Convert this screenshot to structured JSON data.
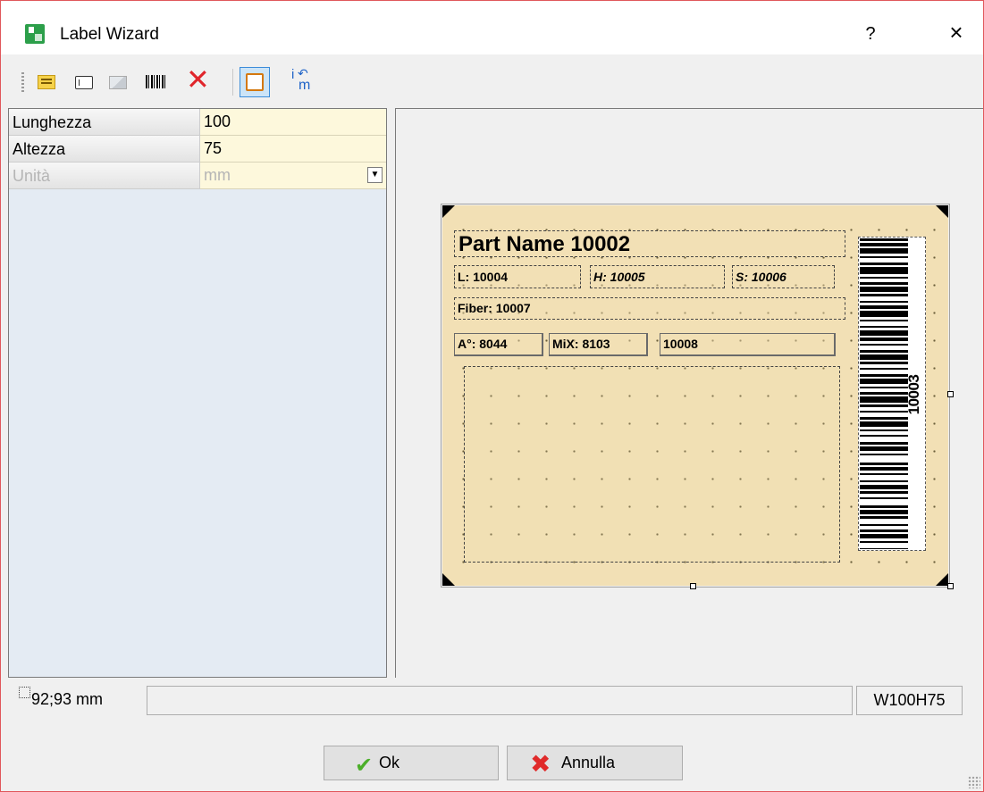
{
  "window": {
    "title": "Label Wizard",
    "help": "?",
    "close": "×"
  },
  "toolbar": {
    "items": [
      "text-icon",
      "field-icon",
      "image-icon",
      "barcode-icon",
      "delete-icon",
      "frame-icon",
      "unit-icon"
    ],
    "delete_glyph": "✕",
    "unit_i": "i",
    "unit_arrow": "↶",
    "unit_m": "m"
  },
  "properties": [
    {
      "name": "Lunghezza",
      "value": "100",
      "enabled": true
    },
    {
      "name": "Altezza",
      "value": "75",
      "enabled": true
    },
    {
      "name": "Unità",
      "value": "mm",
      "enabled": false,
      "dropdown_glyph": "▼"
    }
  ],
  "label": {
    "part_name": "Part Name 10002",
    "l": "L: 10004",
    "h": "H: 10005",
    "s": "S: 10006",
    "fiber": "Fiber: 10007",
    "a": "A°: 8044",
    "mix": "MiX: 8103",
    "x": "10008",
    "barcode_value": "10003",
    "background_color": "#f2e0b5"
  },
  "status": {
    "position": "92;93 mm",
    "size_code": "W100H75"
  },
  "buttons": {
    "ok": "Ok",
    "cancel": "Annulla",
    "ok_glyph": "✔",
    "cancel_glyph": "✖"
  }
}
